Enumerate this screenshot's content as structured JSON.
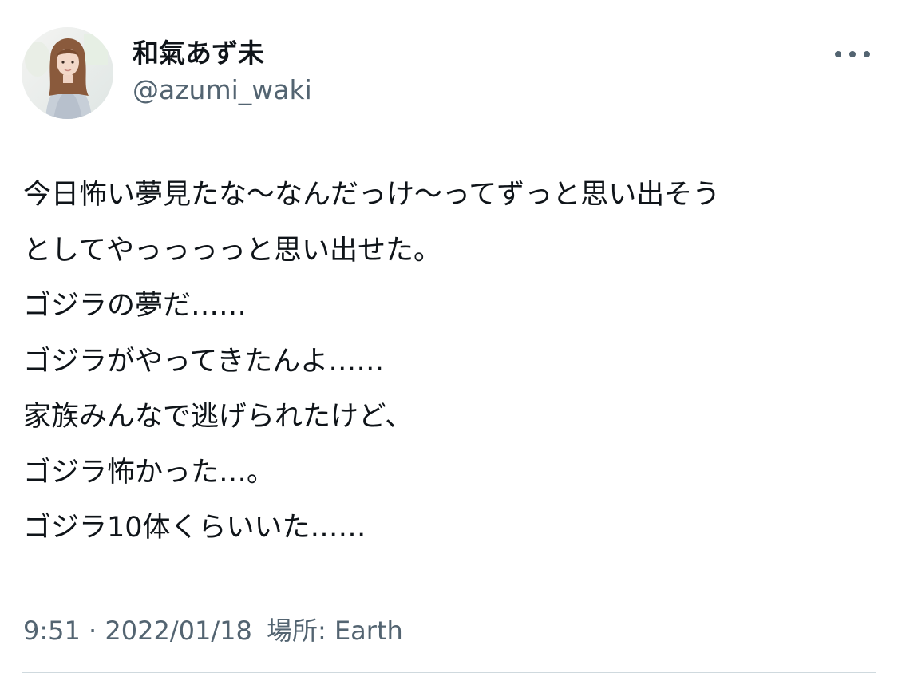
{
  "author": {
    "display_name": "和氣あず未",
    "handle": "@azumi_waki"
  },
  "tweet": {
    "lines": [
      "今日怖い夢見たな〜なんだっけ〜ってずっと思い出そう",
      "としてやっっっっと思い出せた。",
      "ゴジラの夢だ……",
      "ゴジラがやってきたんよ……",
      "家族みんなで逃げられたけど、",
      "ゴジラ怖かった…。",
      "ゴジラ10体くらいいた……"
    ]
  },
  "meta": {
    "time": "9:51",
    "separator": " · ",
    "date": "2022/01/18",
    "location_label": "場所:",
    "location": "Earth"
  },
  "icons": {
    "more": "more-horizontal-icon",
    "avatar": "profile-photo"
  }
}
